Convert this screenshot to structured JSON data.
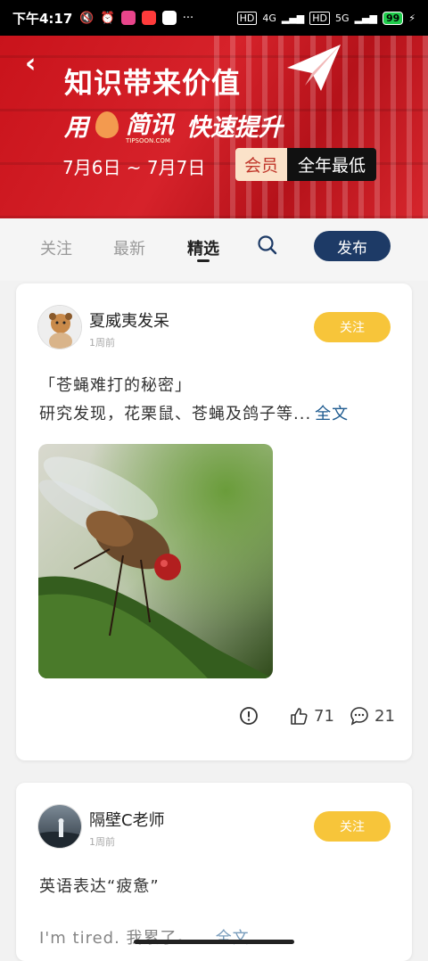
{
  "status_bar": {
    "time": "下午4:17",
    "net1": "4G",
    "net2": "5G",
    "hd1": "HD",
    "hd2": "HD",
    "battery": "99"
  },
  "banner": {
    "title": "知识带来价值",
    "line2_prefix": "用",
    "brand": "简讯",
    "brand_sub": "TIPSOON.COM",
    "line2_suffix": "快速提升",
    "date_range": "7月6日 ~ 7月7日",
    "tag_member": "会员",
    "tag_offer": "全年最低"
  },
  "tabs": {
    "items": [
      "关注",
      "最新",
      "精选"
    ],
    "active": "精选",
    "publish": "发布"
  },
  "posts": [
    {
      "user": "夏威夷发呆",
      "time": "1周前",
      "follow": "关注",
      "title": "「苍蝇难打的秘密」",
      "body": "研究发现，花栗鼠、苍蝇及鸽子等...",
      "more": "全文",
      "likes": "71",
      "comments": "21"
    },
    {
      "user": "隔壁C老师",
      "time": "1周前",
      "follow": "关注",
      "title": "英语表达“疲惫”",
      "body": "I'm tired. 我累了。...",
      "more": "全文"
    }
  ],
  "colors": {
    "banner_red": "#d6222a",
    "publish_navy": "#1d3a66",
    "follow_yellow": "#f7c53a",
    "link_blue": "#1d5a8f"
  }
}
